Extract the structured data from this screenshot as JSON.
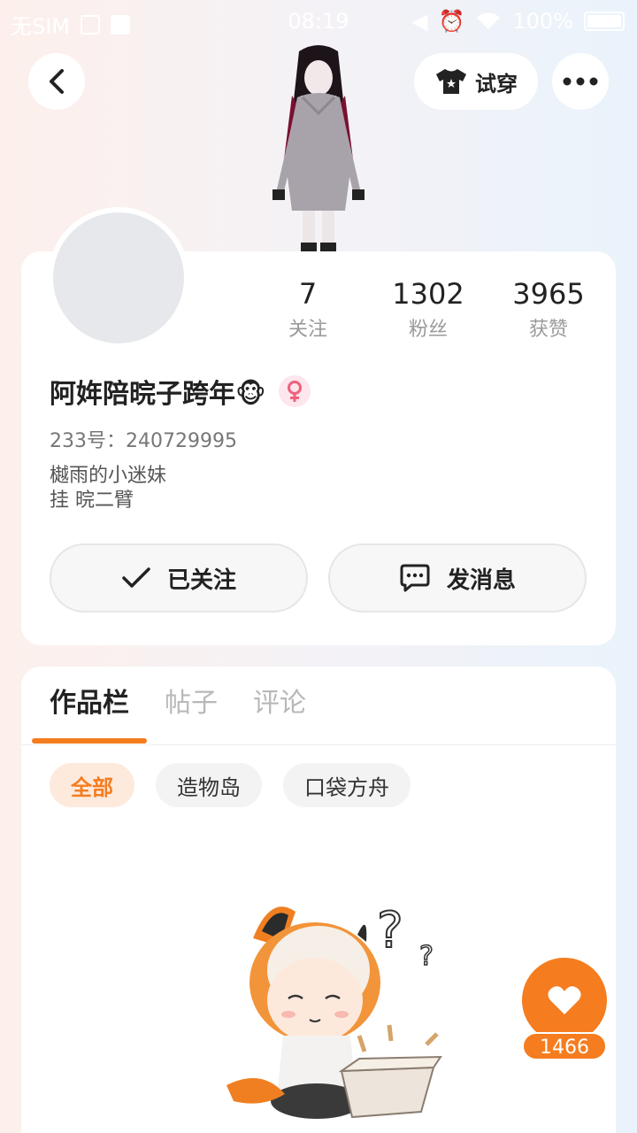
{
  "status_bar": {
    "carrier": "无SIM",
    "time": "08:19",
    "battery": "100%"
  },
  "header": {
    "tryon_label": "试穿"
  },
  "profile": {
    "stats": [
      {
        "num": "7",
        "label": "关注"
      },
      {
        "num": "1302",
        "label": "粉丝"
      },
      {
        "num": "3965",
        "label": "获赞"
      }
    ],
    "nickname": "阿姩陪晥子跨年",
    "nickname_emoji": "🐵",
    "gender_symbol": "♀",
    "uid": "233号：240729995",
    "bio_line1": "樾雨的小迷妹",
    "bio_line2": "挂 晥二臂",
    "follow_label": "已关注",
    "message_label": "发消息"
  },
  "tabs": [
    "作品栏",
    "帖子",
    "评论"
  ],
  "chips": [
    "全部",
    "造物岛",
    "口袋方舟"
  ],
  "like": {
    "count": "1466"
  },
  "colors": {
    "accent": "#f57c1f",
    "gender_pink": "#f0607f"
  }
}
